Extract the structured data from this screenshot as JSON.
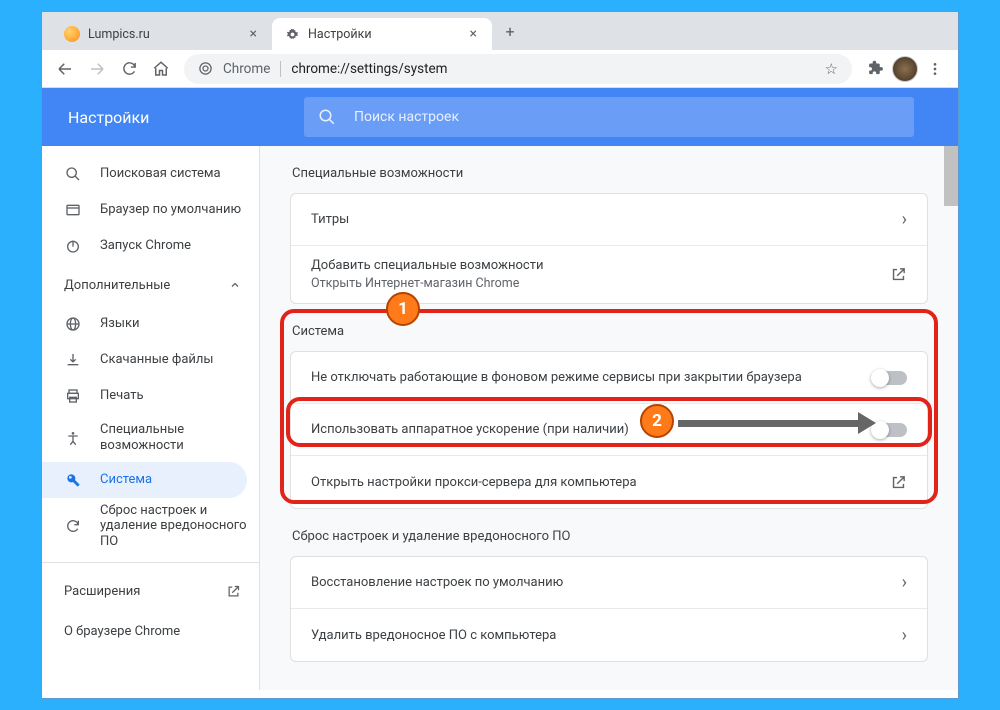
{
  "tabs": [
    {
      "title": "Lumpics.ru",
      "favicon": "orange"
    },
    {
      "title": "Настройки",
      "favicon": "gear"
    }
  ],
  "omnibox": {
    "prefix": "Chrome",
    "path": "chrome://settings/system"
  },
  "settings_header": {
    "title": "Настройки",
    "search_placeholder": "Поиск настроек"
  },
  "sidebar": {
    "items": [
      {
        "label": "Поисковая система"
      },
      {
        "label": "Браузер по умолчанию"
      },
      {
        "label": "Запуск Chrome"
      }
    ],
    "advanced_label": "Дополнительные",
    "advanced_items": [
      {
        "label": "Языки"
      },
      {
        "label": "Скачанные файлы"
      },
      {
        "label": "Печать"
      },
      {
        "label": "Специальные возможности"
      },
      {
        "label": "Система"
      },
      {
        "label": "Сброс настроек и удаление вредоносного ПО"
      }
    ],
    "extensions_label": "Расширения",
    "about_label": "О браузере Chrome"
  },
  "content": {
    "a11y_heading": "Специальные возможности",
    "a11y_rows": [
      {
        "label": "Титры"
      },
      {
        "label": "Добавить специальные возможности",
        "sub": "Открыть Интернет-магазин Chrome"
      }
    ],
    "system_heading": "Система",
    "system_rows": [
      {
        "label": "Не отключать работающие в фоновом режиме сервисы при закрытии браузера"
      },
      {
        "label": "Использовать аппаратное ускорение (при наличии)"
      },
      {
        "label": "Открыть настройки прокси-сервера для компьютера"
      }
    ],
    "reset_heading": "Сброс настроек и удаление вредоносного ПО",
    "reset_rows": [
      {
        "label": "Восстановление настроек по умолчанию"
      },
      {
        "label": "Удалить вредоносное ПО с компьютера"
      }
    ]
  },
  "annotations": {
    "badge1": "1",
    "badge2": "2"
  }
}
